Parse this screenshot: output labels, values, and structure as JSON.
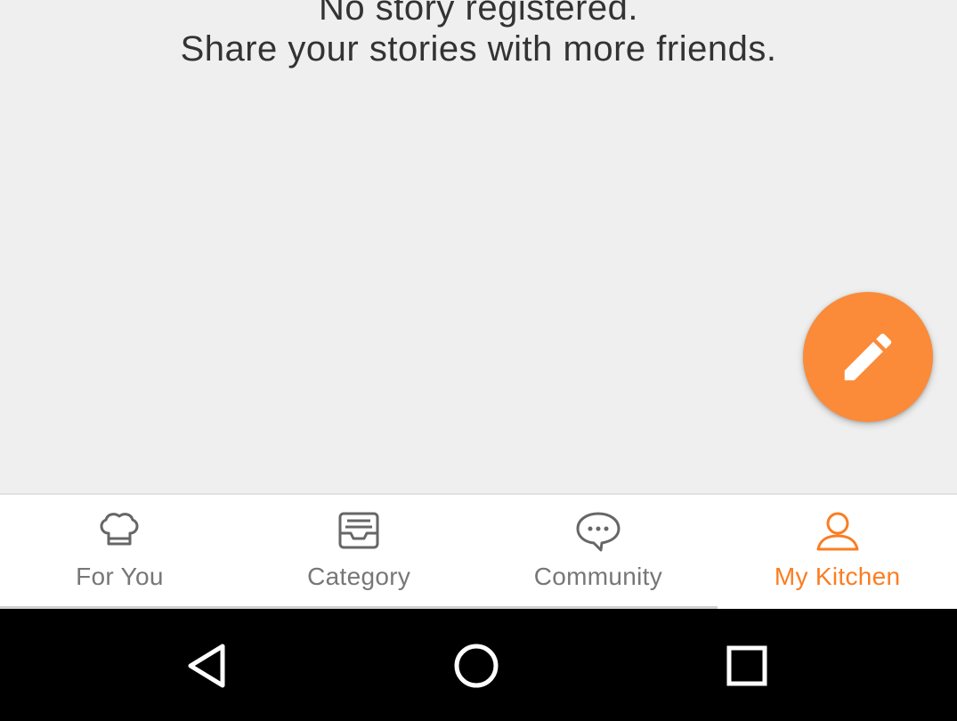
{
  "empty_state": {
    "line1": "No story registered.",
    "line2": "Share your stories with more friends."
  },
  "fab": {
    "icon": "pencil-icon",
    "color": "#fb8a39"
  },
  "tabs": [
    {
      "label": "For You",
      "icon": "chef-hat-icon",
      "active": false
    },
    {
      "label": "Category",
      "icon": "inbox-tray-icon",
      "active": false
    },
    {
      "label": "Community",
      "icon": "chat-bubble-icon",
      "active": false
    },
    {
      "label": "My Kitchen",
      "icon": "person-icon",
      "active": true
    }
  ],
  "colors": {
    "accent": "#fb7d22",
    "inactive": "#777777",
    "background": "#eeefee"
  },
  "system_nav": {
    "back_icon": "back-triangle-icon",
    "home_icon": "home-circle-icon",
    "recents_icon": "recents-square-icon"
  }
}
